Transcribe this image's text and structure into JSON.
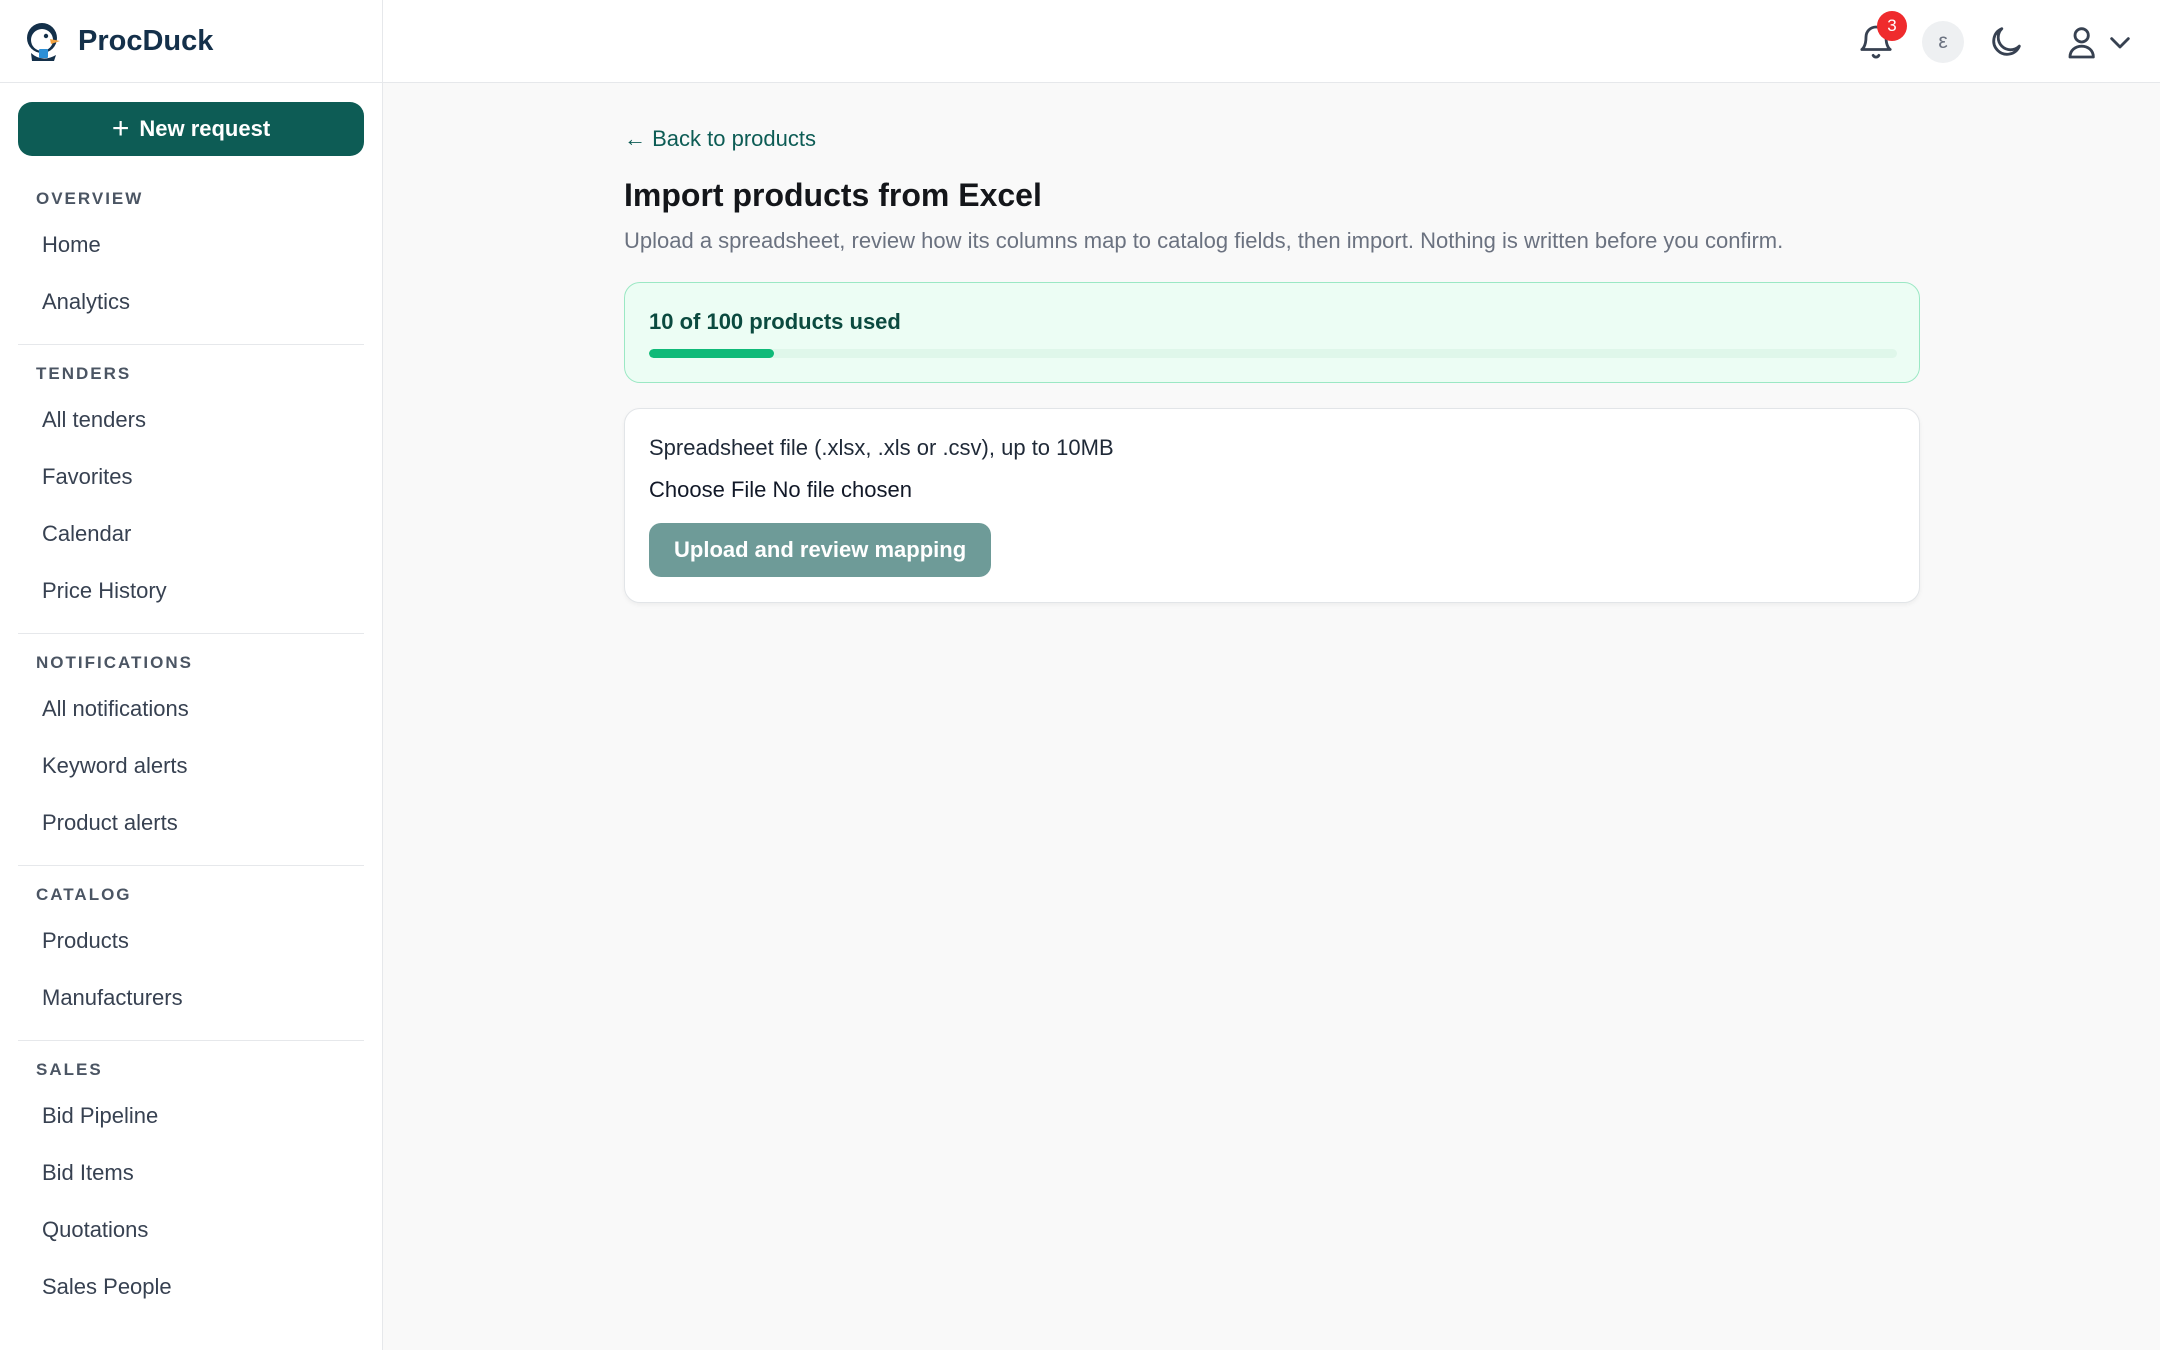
{
  "brand": {
    "name": "ProcDuck"
  },
  "sidebar": {
    "new_request_label": "New request",
    "sections": [
      {
        "heading": "OVERVIEW",
        "items": [
          "Home",
          "Analytics"
        ]
      },
      {
        "heading": "TENDERS",
        "items": [
          "All tenders",
          "Favorites",
          "Calendar",
          "Price History"
        ]
      },
      {
        "heading": "NOTIFICATIONS",
        "items": [
          "All notifications",
          "Keyword alerts",
          "Product alerts"
        ]
      },
      {
        "heading": "CATALOG",
        "items": [
          "Products",
          "Manufacturers"
        ]
      },
      {
        "heading": "SALES",
        "items": [
          "Bid Pipeline",
          "Bid Items",
          "Quotations",
          "Sales People"
        ]
      }
    ]
  },
  "topbar": {
    "notification_count": "3",
    "avatar_initial": "ε"
  },
  "main": {
    "back_link": "← Back to products",
    "title": "Import products from Excel",
    "subtitle": "Upload a spreadsheet, review how its columns map to catalog fields, then import. Nothing is written before you confirm.",
    "usage": {
      "text": "10 of 100 products used",
      "used": 10,
      "limit": 100
    },
    "upload": {
      "file_label": "Spreadsheet file (.xlsx, .xls or .csv), up to 10MB",
      "choose_file": "Choose File",
      "no_file": "No file chosen",
      "submit_label": "Upload and review mapping"
    }
  },
  "colors": {
    "accent": "#0d5c55",
    "badge": "#ef2b2d",
    "progress": "#0fba78"
  }
}
